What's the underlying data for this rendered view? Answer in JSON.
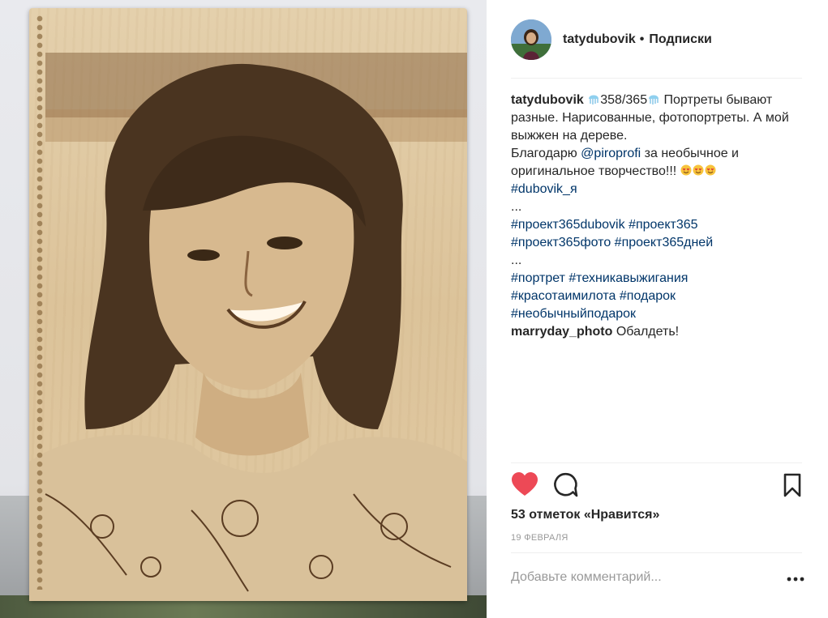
{
  "header": {
    "username": "tatydubovik",
    "separator": "•",
    "follow_label": "Подписки"
  },
  "caption": {
    "username": "tatydubovik",
    "counter": "358/365",
    "line1": " Портреты бывают разные. Нарисованные, фотопортреты. А мой выжжен на дереве.",
    "thanks_pre": "Благодарю ",
    "mention": "@piroprofi",
    "thanks_post": " за необычное и оригинальное творчество!!! ",
    "tag_main": "#dubovik_я",
    "ellipsis1": "...",
    "tags_project": [
      "#проект365dubovik",
      "#проект365",
      "#проект365фото",
      "#проект365дней"
    ],
    "ellipsis2": "...",
    "tags_theme": [
      "#портрет",
      "#техникавыжигания",
      "#красотаимилота",
      "#подарок",
      "#необычныйподарок"
    ]
  },
  "comments": [
    {
      "username": "marryday_photo",
      "text": "Обалдеть!"
    }
  ],
  "likes": "53 отметок «Нравится»",
  "date": "19 ФЕВРАЛЯ",
  "comment_input": {
    "placeholder": "Добавьте комментарий..."
  },
  "icons": {
    "like": "heart-filled-icon",
    "comment": "speech-bubble-icon",
    "save": "bookmark-icon",
    "more": "ellipsis-icon",
    "counter_emoji": "jellyfish-icon",
    "caption_emoji": "smiling-face-heart-eyes-icon"
  },
  "colors": {
    "like_red": "#ed4956",
    "link_blue": "#003569",
    "muted_gray": "#999999",
    "text": "#262626"
  }
}
